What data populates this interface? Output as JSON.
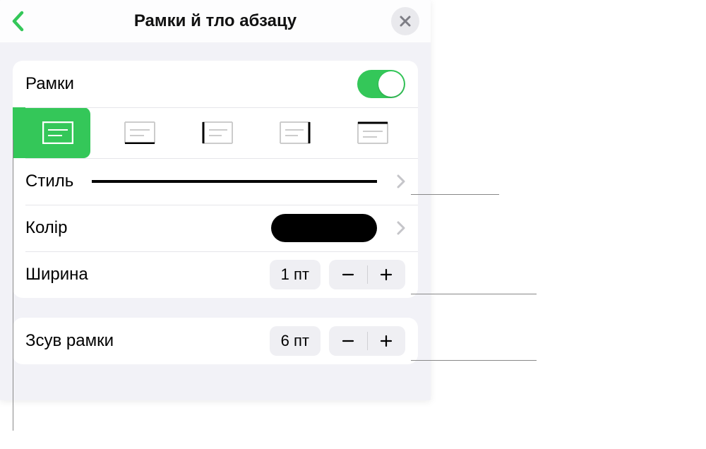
{
  "header": {
    "title": "Рамки й тло абзацу"
  },
  "frames": {
    "label": "Рамки",
    "enabled": true
  },
  "style": {
    "label": "Стиль"
  },
  "color": {
    "label": "Колір",
    "value": "#000000"
  },
  "width": {
    "label": "Ширина",
    "value": "1 пт"
  },
  "offset": {
    "label": "Зсув рамки",
    "value": "6 пт"
  },
  "border_options": [
    {
      "name": "border-all",
      "selected": true
    },
    {
      "name": "border-bottom",
      "selected": false
    },
    {
      "name": "border-left",
      "selected": false
    },
    {
      "name": "border-right",
      "selected": false
    },
    {
      "name": "border-top",
      "selected": false
    }
  ]
}
